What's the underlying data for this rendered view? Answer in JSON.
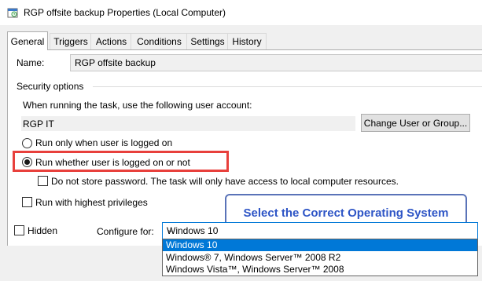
{
  "window": {
    "title": "RGP offsite backup Properties (Local Computer)"
  },
  "tabs": [
    "General",
    "Triggers",
    "Actions",
    "Conditions",
    "Settings",
    "History"
  ],
  "general": {
    "name_label": "Name:",
    "name_value": "RGP offsite backup",
    "security_group": "Security options",
    "account_prompt": "When running the task, use the following user account:",
    "account_value": "RGP IT",
    "change_button": "Change User or Group...",
    "radio_logged_on": "Run only when user is logged on",
    "radio_whether": "Run whether user is logged on or not",
    "no_store_password": "Do not store password.  The task will only have access to local computer resources.",
    "highest_privileges": "Run with highest privileges",
    "hidden_label": "Hidden",
    "configure_label": "Configure for:",
    "configure_value": "Windows 10",
    "configure_options": [
      "Windows 10",
      "Windows® 7, Windows Server™ 2008 R2",
      "Windows Vista™, Windows Server™ 2008"
    ]
  },
  "annotation": {
    "text": "Select the Correct Operating System",
    "color": "#2e55c6"
  },
  "colors": {
    "highlight_border": "#e8403c",
    "selection": "#0078d7"
  }
}
